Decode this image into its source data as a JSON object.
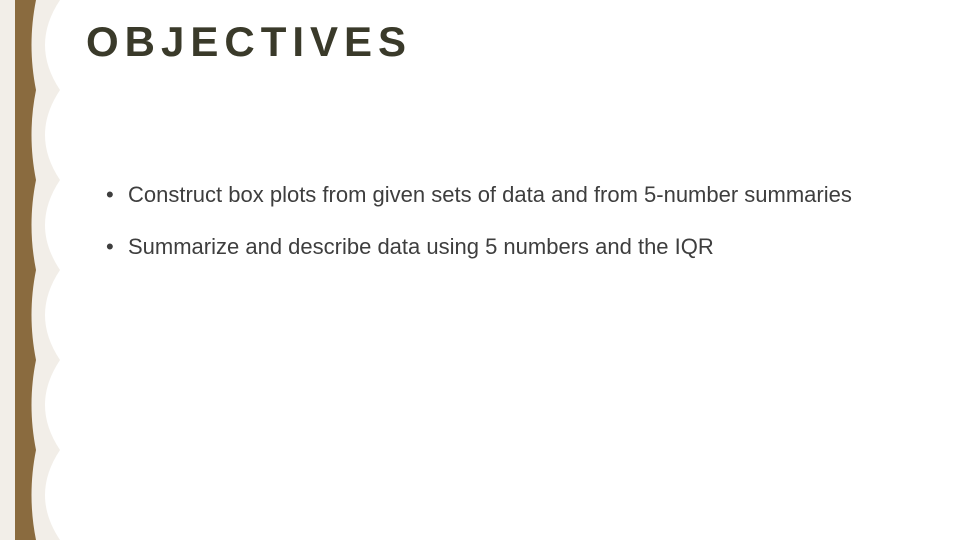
{
  "title": "OBJECTIVES",
  "bullets": [
    "Construct box plots from given sets of data and from 5-number summaries",
    "Summarize and describe data using 5 numbers and the IQR"
  ],
  "decoration": {
    "bar_color": "#8a6b3f",
    "wave_color": "#f2eee8"
  }
}
